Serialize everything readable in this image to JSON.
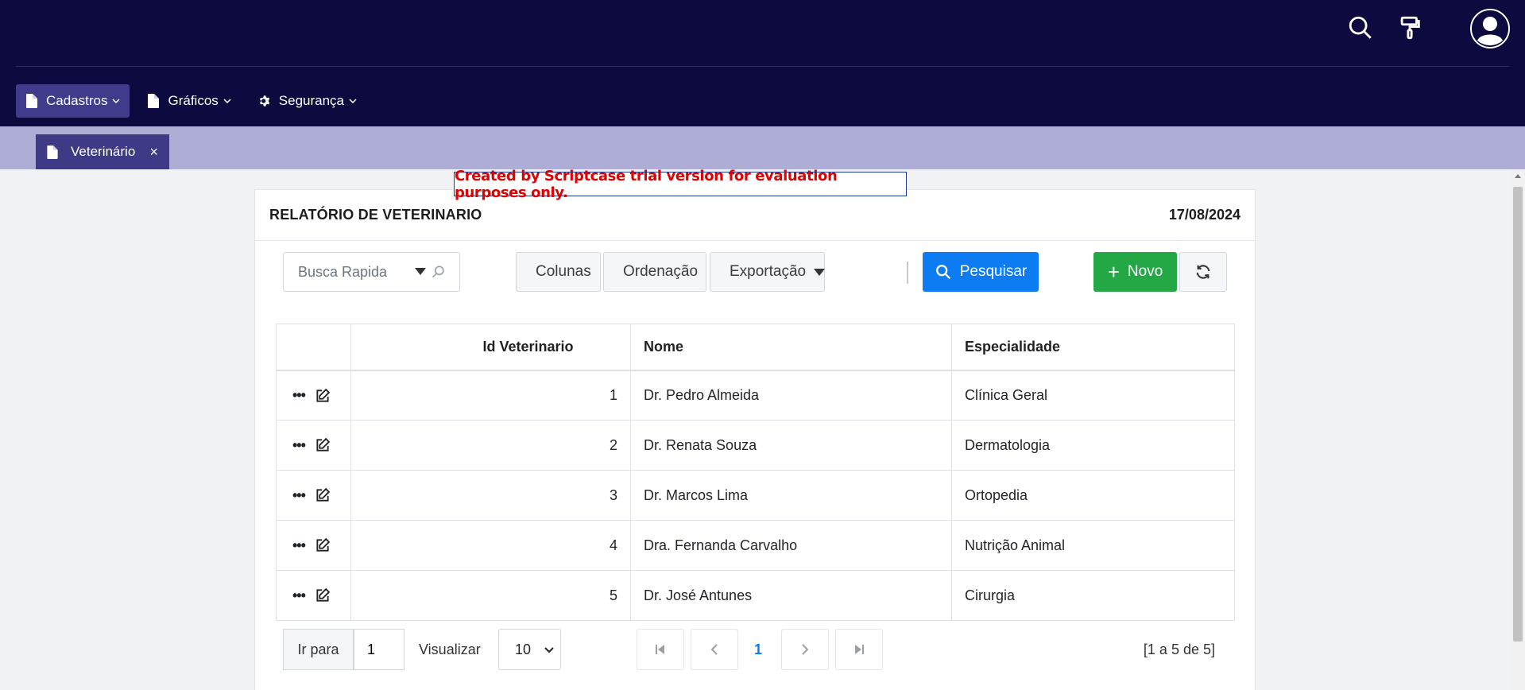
{
  "header": {
    "menu": [
      {
        "label": "Cadastros",
        "icon": "file-icon",
        "active": true
      },
      {
        "label": "Gráficos",
        "icon": "file-icon",
        "active": false
      },
      {
        "label": "Segurança",
        "icon": "gear-icon",
        "active": false
      }
    ],
    "icons": [
      "search-icon",
      "paint-roller-icon",
      "user-avatar-icon"
    ]
  },
  "tabs": [
    {
      "label": "Veterinário",
      "close": "×"
    }
  ],
  "trial_notice": "Created by Scriptcase trial version for evaluation purposes only.",
  "report": {
    "title": "RELATÓRIO DE VETERINARIO",
    "date": "17/08/2024"
  },
  "toolbar": {
    "quick_search_placeholder": "Busca Rapida",
    "columns_label": "Colunas",
    "sort_label": "Ordenação",
    "export_label": "Exportação",
    "search_label": "Pesquisar",
    "new_label": "Novo"
  },
  "table": {
    "headers": [
      "",
      "Id Veterinario",
      "Nome",
      "Especialidade"
    ],
    "rows": [
      {
        "id": "1",
        "nome": "Dr. Pedro Almeida",
        "especialidade": "Clínica Geral"
      },
      {
        "id": "2",
        "nome": "Dr. Renata Souza",
        "especialidade": "Dermatologia"
      },
      {
        "id": "3",
        "nome": "Dr. Marcos Lima",
        "especialidade": "Ortopedia"
      },
      {
        "id": "4",
        "nome": "Dra. Fernanda Carvalho",
        "especialidade": "Nutrição Animal"
      },
      {
        "id": "5",
        "nome": "Dr. José Antunes",
        "especialidade": "Cirurgia"
      }
    ]
  },
  "footer": {
    "goto_label": "Ir para",
    "goto_value": "1",
    "view_label": "Visualizar",
    "page_size": "10",
    "current_page": "1",
    "range": "[1 a 5 de 5]"
  },
  "colors": {
    "header_bg": "#0c0a3e",
    "menu_active": "#413b8c",
    "tabs_bg": "#aeadd5",
    "tab_active": "#3e3a85",
    "primary": "#0d7cf2",
    "success": "#24a745",
    "trial_text": "#e00000"
  }
}
